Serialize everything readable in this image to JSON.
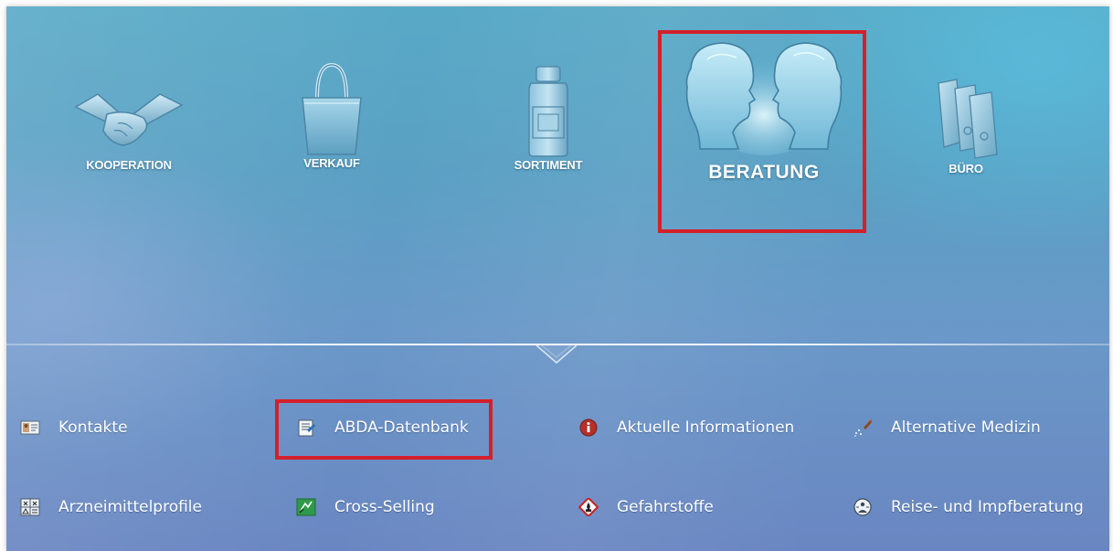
{
  "categories": [
    {
      "label": "KOOPERATION",
      "icon": "handshake-icon"
    },
    {
      "label": "VERKAUF",
      "icon": "shopping-bag-icon"
    },
    {
      "label": "SORTIMENT",
      "icon": "medicine-jar-icon"
    },
    {
      "label": "BERATUNG",
      "icon": "two-faces-icon",
      "active": true
    },
    {
      "label": "BÜRO",
      "icon": "binders-icon"
    }
  ],
  "submenu": [
    {
      "label": "Kontakte",
      "icon": "contact-card-icon"
    },
    {
      "label": "ABDA-Datenbank",
      "icon": "database-document-icon",
      "highlighted": true
    },
    {
      "label": "Aktuelle Informationen",
      "icon": "info-icon"
    },
    {
      "label": "Alternative Medizin",
      "icon": "homeopathy-icon"
    },
    {
      "label": "Arzneimittelprofile",
      "icon": "drug-profile-icon"
    },
    {
      "label": "Cross-Selling",
      "icon": "cross-selling-icon"
    },
    {
      "label": "Gefahrstoffe",
      "icon": "hazard-icon"
    },
    {
      "label": "Reise- und Impfberatung",
      "icon": "travel-vaccination-icon"
    }
  ],
  "colors": {
    "highlight": "#d4202a",
    "text": "#ffffff"
  }
}
